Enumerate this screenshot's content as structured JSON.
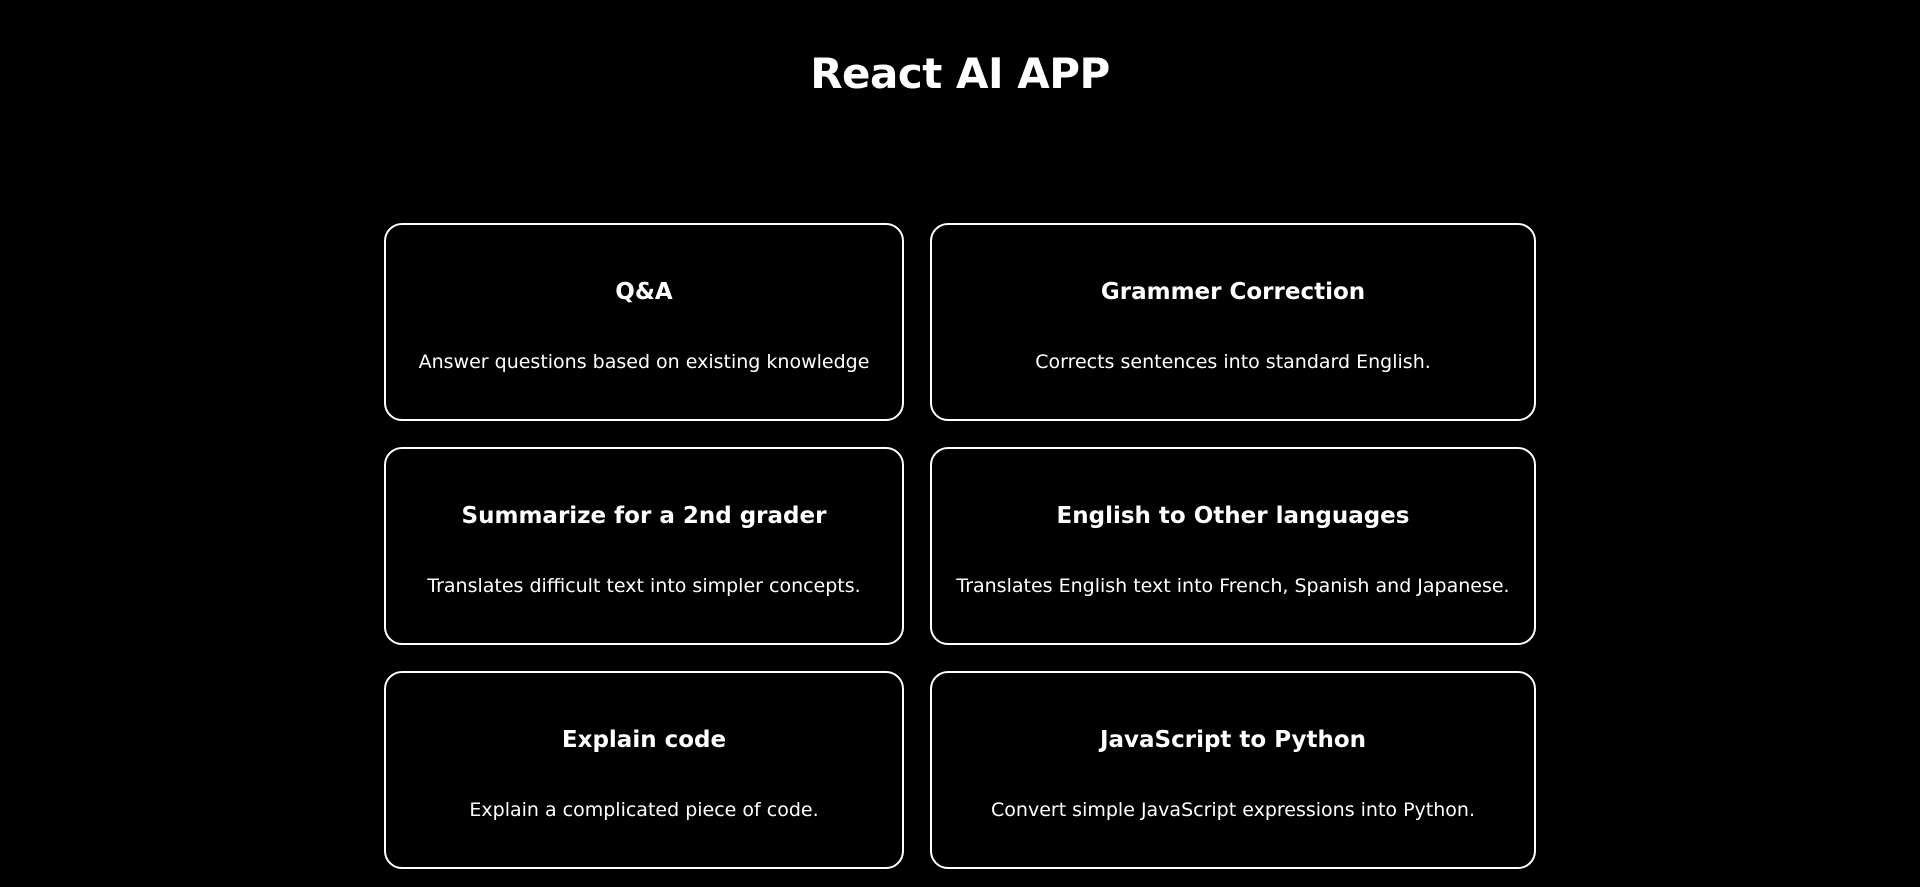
{
  "app": {
    "title": "React AI APP"
  },
  "cards": [
    {
      "title": "Q&A",
      "description": "Answer questions based on existing knowledge"
    },
    {
      "title": "Grammer Correction",
      "description": "Corrects sentences into standard English."
    },
    {
      "title": "Summarize for a 2nd grader",
      "description": "Translates difficult text into simpler concepts."
    },
    {
      "title": "English to Other languages",
      "description": "Translates English text into French, Spanish and Japanese."
    },
    {
      "title": "Explain code",
      "description": "Explain a complicated piece of code."
    },
    {
      "title": "JavaScript to Python",
      "description": "Convert simple JavaScript expressions into Python."
    }
  ],
  "colors": {
    "background": "#000000",
    "foreground": "#ffffff",
    "card_border": "#ffffff"
  }
}
